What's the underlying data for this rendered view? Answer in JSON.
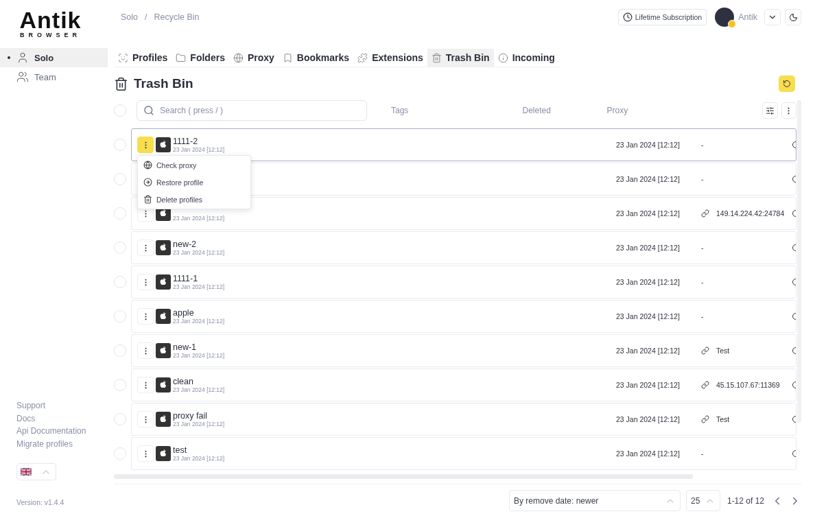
{
  "logo": {
    "name": "Antik",
    "tagline": "BROWSER"
  },
  "breadcrumb": {
    "items": [
      "Solo",
      "Recycle Bin"
    ],
    "separator": "/"
  },
  "header": {
    "subscription": "Lifetime Subscription",
    "user": "Antik"
  },
  "sidebar": {
    "items": [
      {
        "label": "Solo",
        "kind": "person",
        "selected": true
      },
      {
        "label": "Team",
        "kind": "group",
        "selected": false
      }
    ],
    "links": [
      "Support",
      "Docs",
      "Api Documentation",
      "Migrate profiles"
    ],
    "version": "Version: v1.4.4"
  },
  "tabs": [
    {
      "label": "Profiles",
      "kind": "profiles",
      "selected": false
    },
    {
      "label": "Folders",
      "kind": "folders",
      "selected": false
    },
    {
      "label": "Proxy",
      "kind": "proxy",
      "selected": false
    },
    {
      "label": "Bookmarks",
      "kind": "bookmarks",
      "selected": false
    },
    {
      "label": "Extensions",
      "kind": "extensions",
      "selected": false
    },
    {
      "label": "Trash Bin",
      "kind": "trash",
      "selected": true
    },
    {
      "label": "Incoming",
      "kind": "info",
      "selected": false
    }
  ],
  "title": "Trash Bin",
  "table": {
    "select_all": {
      "checked": false
    },
    "search": {
      "placeholder": "Search ( press / )"
    },
    "columns": [
      "Tags",
      "Deleted",
      "Proxy"
    ],
    "rows": [
      {
        "name": "1111-2",
        "date": "23 Jan 2024 [12:12]",
        "deleted": "23 Jan 2024 [12:12]",
        "proxy": "-",
        "proxy_link": false,
        "selected": true,
        "checked": false,
        "menu_open": true
      },
      {
        "deleted": "23 Jan 2024 [12:12]",
        "proxy": "-",
        "proxy_link": false,
        "selected": false,
        "checked": false,
        "menu_open": false
      },
      {
        "date": "23 Jan 2024 [12:12]",
        "deleted": "23 Jan 2024 [12:12]",
        "proxy": "149.14.224.42:24784",
        "proxy_link": true,
        "selected": false,
        "checked": false,
        "menu_open": false
      },
      {
        "name": "new-2",
        "date": "23 Jan 2024 [12:12]",
        "deleted": "23 Jan 2024 [12:12]",
        "proxy": "-",
        "proxy_link": false,
        "selected": false,
        "checked": false,
        "menu_open": false
      },
      {
        "name": "1111-1",
        "date": "23 Jan 2024 [12:12]",
        "deleted": "23 Jan 2024 [12:12]",
        "proxy": "-",
        "proxy_link": false,
        "selected": false,
        "checked": false,
        "menu_open": false
      },
      {
        "name": "apple",
        "date": "23 Jan 2024 [12:12]",
        "deleted": "23 Jan 2024 [12:12]",
        "proxy": "-",
        "proxy_link": false,
        "selected": false,
        "checked": false,
        "menu_open": false
      },
      {
        "name": "new-1",
        "date": "23 Jan 2024 [12:12]",
        "deleted": "23 Jan 2024 [12:12]",
        "proxy": "Test",
        "proxy_link": true,
        "selected": false,
        "checked": false,
        "menu_open": false
      },
      {
        "name": "clean",
        "date": "23 Jan 2024 [12:12]",
        "deleted": "23 Jan 2024 [12:12]",
        "proxy": "45.15.107.67:11369",
        "proxy_link": true,
        "selected": false,
        "checked": false,
        "menu_open": false
      },
      {
        "name": "proxy fail",
        "date": "23 Jan 2024 [12:12]",
        "deleted": "23 Jan 2024 [12:12]",
        "proxy": "Test",
        "proxy_link": true,
        "selected": false,
        "checked": false,
        "menu_open": false
      },
      {
        "name": "test",
        "date": "23 Jan 2024 [12:12]",
        "deleted": "23 Jan 2024 [12:12]",
        "proxy": "-",
        "proxy_link": false,
        "selected": false,
        "checked": false,
        "menu_open": false
      }
    ]
  },
  "context_menu": [
    {
      "label": "Check proxy",
      "kind": "check"
    },
    {
      "label": "Restore profile",
      "kind": "restore"
    },
    {
      "label": "Delete profiles",
      "kind": "delete"
    }
  ],
  "footer": {
    "sort": "By remove date: newer",
    "page_size": "25",
    "range": "1-12 of 12"
  }
}
